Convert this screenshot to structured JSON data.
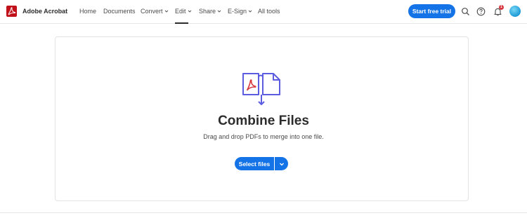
{
  "app": {
    "brand_name": "Adobe Acrobat",
    "logo_icon": "acrobat-logo-icon",
    "brand_color": "#c1121c",
    "accent_color": "#1473e6"
  },
  "nav": {
    "items": [
      {
        "label": "Home",
        "has_dropdown": false
      },
      {
        "label": "Documents",
        "has_dropdown": false
      },
      {
        "label": "Convert",
        "has_dropdown": true
      },
      {
        "label": "Edit",
        "has_dropdown": true,
        "active": true
      },
      {
        "label": "Share",
        "has_dropdown": true
      },
      {
        "label": "E-Sign",
        "has_dropdown": true
      },
      {
        "label": "All tools",
        "has_dropdown": false
      }
    ]
  },
  "header_actions": {
    "cta_label": "Start free trial",
    "search_icon": "search-icon",
    "help_icon": "help-icon",
    "notifications_icon": "bell-icon",
    "notification_count": "1",
    "avatar": "user-avatar"
  },
  "main": {
    "hero_icon": "combine-files-icon",
    "title": "Combine Files",
    "subtitle": "Drag and drop PDFs to merge into one file.",
    "select_button_label": "Select files",
    "dropdown_icon": "chevron-down-icon"
  }
}
